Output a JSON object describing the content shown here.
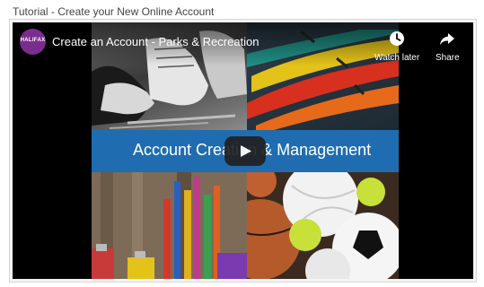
{
  "page": {
    "title": "Tutorial - Create your New Online Account"
  },
  "video": {
    "title": "Create an Account - Parks & Recreation",
    "channel_logo_text": "HALIFAX",
    "banner_text": "Account Creation & Management",
    "controls": {
      "watch_later_label": "Watch later",
      "share_label": "Share"
    }
  },
  "colors": {
    "banner_blue": "#1f6db0",
    "channel_logo": "#7b2d8e",
    "play_button": "#212121"
  },
  "icons": [
    "clock-icon",
    "share-arrow-icon",
    "play-icon"
  ]
}
